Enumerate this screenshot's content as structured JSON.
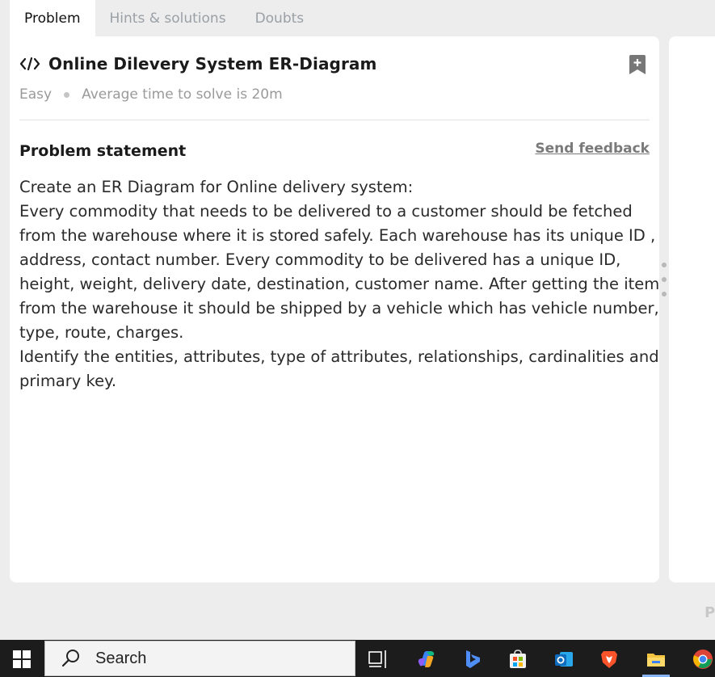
{
  "tabs": [
    {
      "label": "Problem",
      "active": true
    },
    {
      "label": "Hints & solutions",
      "active": false
    },
    {
      "label": "Doubts",
      "active": false
    }
  ],
  "problem": {
    "title": "Online Dilevery System ER-Diagram",
    "difficulty": "Easy",
    "avg_time": "Average time to solve is 20m",
    "statement_heading": "Problem statement",
    "feedback_label": "Send feedback",
    "statement_lines": [
      "Create an ER Diagram for Online delivery system:",
      "Every commodity that needs to be delivered to a customer should be fetched",
      "from the warehouse where it is stored safely. Each warehouse has its unique ID ,",
      "address, contact number. Every commodity to be delivered has a unique ID,",
      "height, weight, delivery date, destination, customer name. After getting the item",
      "from the warehouse it should be shipped by a vehicle which has vehicle number,",
      "type, route, charges.",
      "Identify the entities, attributes, type of attributes, relationships, cardinalities and",
      "primary key."
    ]
  },
  "right_panel": {
    "corner_letter": "P"
  },
  "taskbar": {
    "search_label": "Search",
    "icons": [
      "windows-start-icon",
      "task-view-icon",
      "copilot-icon",
      "bing-icon",
      "store-icon",
      "outlook-icon",
      "brave-icon",
      "file-explorer-icon",
      "chrome-icon"
    ]
  },
  "colors": {
    "page_bg": "#ededed",
    "card_bg": "#ffffff",
    "muted": "#9aa0a6",
    "taskbar": "#1c1c1c"
  }
}
